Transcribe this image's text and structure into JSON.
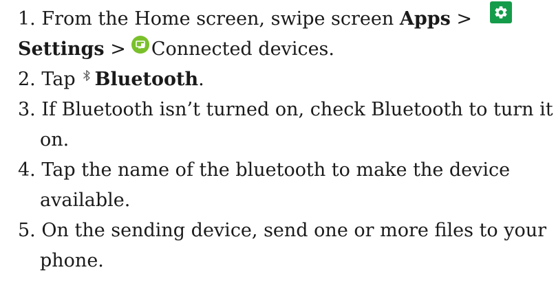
{
  "steps": [
    {
      "num": "1.",
      "part1": "From the Home screen, swipe screen",
      "apps": "Apps",
      "sep1": ">",
      "settings": "Settings",
      "sep2": ">",
      "connected": "Connected devices."
    },
    {
      "num": "2.",
      "pre": "Tap",
      "bold": "Bluetooth",
      "post": "."
    },
    {
      "num": "3.",
      "line1": "If Bluetooth isn’t turned on, check Bluetooth to turn it",
      "line2": "on."
    },
    {
      "num": "4.",
      "line1": "Tap the name of the bluetooth to make the device",
      "line2": "available."
    },
    {
      "num": "5.",
      "line1": "On the sending device, send one or more files to your",
      "line2": "phone."
    }
  ],
  "icons": {
    "settings": "gear-icon",
    "connected_devices": "connected-devices-icon",
    "bluetooth": "bluetooth-icon"
  },
  "colors": {
    "settings_icon_bg": "#159c4a",
    "connected_icon_bg": "#7ac02b"
  }
}
